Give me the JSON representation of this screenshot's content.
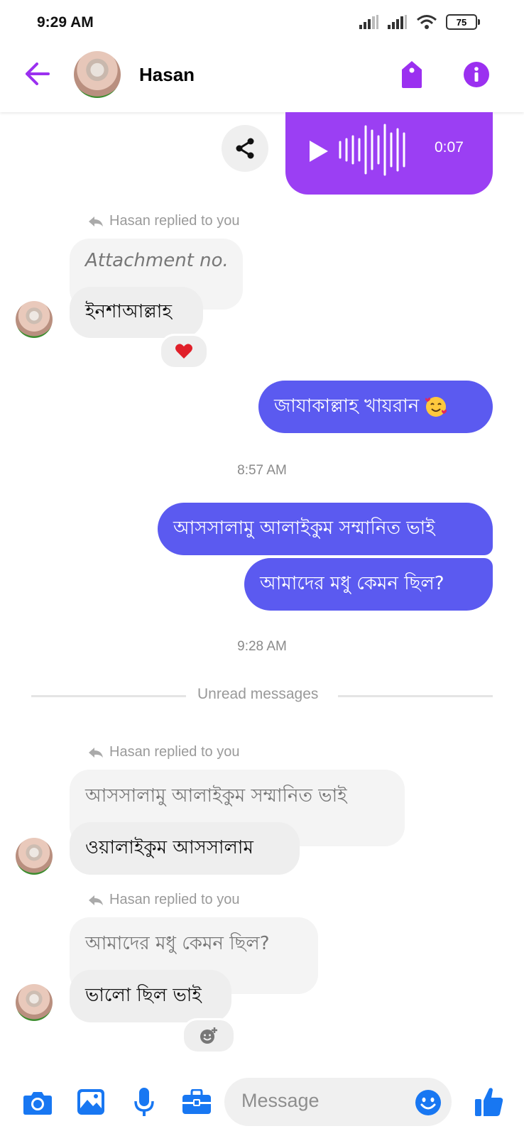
{
  "status_bar": {
    "time": "9:29 AM",
    "battery": "75"
  },
  "header": {
    "contact_name": "Hasan"
  },
  "voice_message": {
    "duration": "0:07"
  },
  "messages": {
    "reply_label": "Hasan replied to you",
    "quote_1": "Attachment no.",
    "incoming_1": "ইনশাআল্লাহ",
    "outgoing_1": "জাযাকাল্লাহ খায়রান",
    "timestamp_1": "8:57 AM",
    "outgoing_2": "আসসালামু আলাইকুম সম্মানিত ভাই",
    "outgoing_3": "আমাদের মধু কেমন ছিল?",
    "timestamp_2": "9:28 AM",
    "unread_label": "Unread messages",
    "quote_2": "আসসালামু আলাইকুম সম্মানিত ভাই",
    "incoming_2": "ওয়ালাইকুম আসসালাম",
    "quote_3": "আমাদের মধু কেমন ছিল?",
    "incoming_3": "ভালো ছিল ভাই"
  },
  "composer": {
    "placeholder": "Message"
  },
  "colors": {
    "accent": "#9b30f0",
    "outgoing_bubble": "#5b5af0",
    "icon_blue": "#1877f2"
  }
}
